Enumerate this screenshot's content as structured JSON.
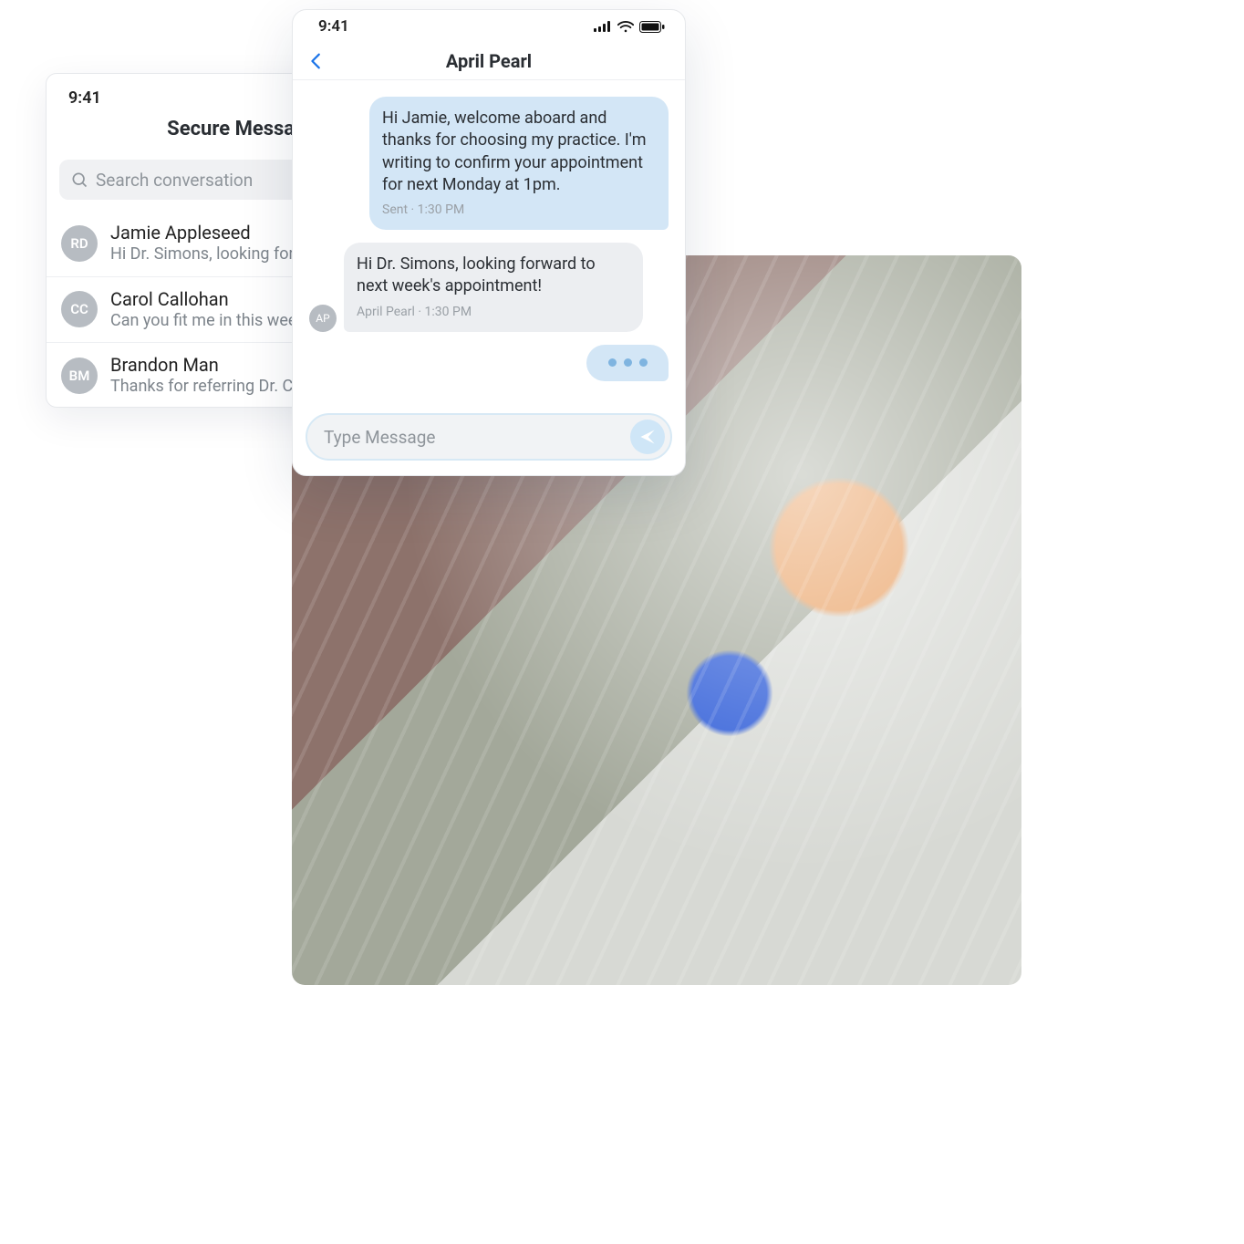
{
  "list_panel": {
    "status_time": "9:41",
    "title": "Secure Messages",
    "search_placeholder": "Search conversation",
    "conversations": [
      {
        "initials": "RD",
        "name": "Jamie Appleseed",
        "preview": "Hi Dr. Simons, looking forward to…"
      },
      {
        "initials": "CC",
        "name": "Carol Callohan",
        "preview": "Can you fit me in this week?"
      },
      {
        "initials": "BM",
        "name": "Brandon Man",
        "preview": "Thanks for referring Dr. Cass…"
      }
    ]
  },
  "chat_panel": {
    "status_time": "9:41",
    "contact_name": "April Pearl",
    "messages": [
      {
        "dir": "out",
        "text": "Hi Jamie, welcome aboard and thanks for choosing my practice. I'm writing to confirm your appointment for next Monday at 1pm.",
        "meta": "Sent · 1:30 PM"
      },
      {
        "dir": "in",
        "initials": "AP",
        "text": "Hi Dr. Simons, looking forward to next week's appointment!",
        "meta": "April Pearl · 1:30 PM"
      }
    ],
    "compose_placeholder": "Type Message"
  },
  "colors": {
    "accent": "#1a73e8",
    "bubble_out": "#d3e6f6",
    "bubble_in": "#eceef1"
  }
}
